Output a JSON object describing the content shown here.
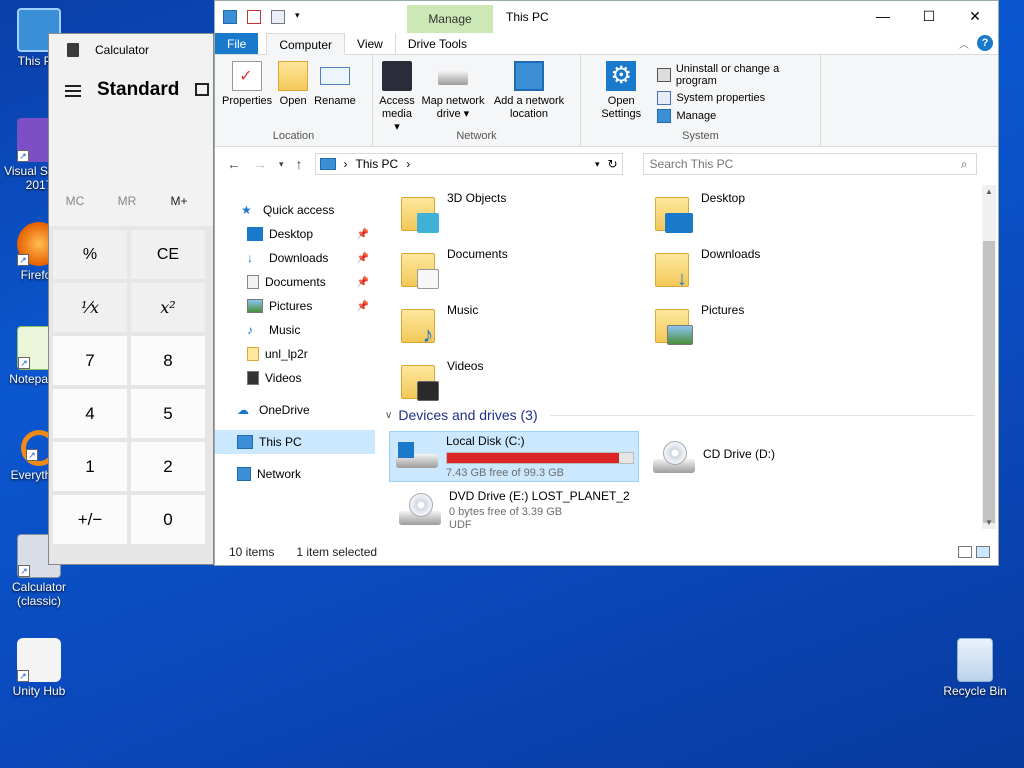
{
  "desktop": {
    "icons": [
      {
        "label": "This PC"
      },
      {
        "label": "Visual Studio 2017"
      },
      {
        "label": "Firefox"
      },
      {
        "label": "Notepad++"
      },
      {
        "label": "Everything"
      },
      {
        "label": "Calculator (classic)"
      },
      {
        "label": "Unity Hub"
      },
      {
        "label": "Recycle Bin"
      }
    ]
  },
  "calculator": {
    "title": "Calculator",
    "mode": "Standard",
    "memory": [
      "MC",
      "MR",
      "M+"
    ],
    "keys": [
      "%",
      "CE",
      "¹⁄x",
      "x²",
      "7",
      "8",
      "4",
      "5",
      "1",
      "2",
      "+/−",
      "0"
    ]
  },
  "explorer": {
    "title": "This PC",
    "manage_label": "Manage",
    "tabs": {
      "file": "File",
      "computer": "Computer",
      "view": "View",
      "drive_tools": "Drive Tools"
    },
    "ribbon": {
      "location": {
        "label": "Location",
        "properties": "Properties",
        "open": "Open",
        "rename": "Rename"
      },
      "network": {
        "label": "Network",
        "access_media": "Access media ▾",
        "map_network_drive": "Map network drive ▾",
        "add_network_location": "Add a network location"
      },
      "system": {
        "label": "System",
        "open_settings": "Open Settings",
        "uninstall": "Uninstall or change a program",
        "system_properties": "System properties",
        "manage": "Manage"
      }
    },
    "address": {
      "path": "This PC",
      "separator": "›",
      "search_placeholder": "Search This PC"
    },
    "nav": [
      {
        "label": "Quick access"
      },
      {
        "label": "Desktop"
      },
      {
        "label": "Downloads"
      },
      {
        "label": "Documents"
      },
      {
        "label": "Pictures"
      },
      {
        "label": "Music"
      },
      {
        "label": "unl_lp2r"
      },
      {
        "label": "Videos"
      },
      {
        "label": "OneDrive"
      },
      {
        "label": "This PC"
      },
      {
        "label": "Network"
      }
    ],
    "folders": [
      "3D Objects",
      "Desktop",
      "Documents",
      "Downloads",
      "Music",
      "Pictures",
      "Videos"
    ],
    "devices_header": "Devices and drives (3)",
    "drives": [
      {
        "name": "Local Disk (C:)",
        "free": "7.43 GB free of 99.3 GB",
        "used_fraction": 0.925
      },
      {
        "name": "CD Drive (D:)"
      },
      {
        "name": "DVD Drive (E:) LOST_PLANET_2",
        "free": "0 bytes free of 3.39 GB",
        "fs": "UDF"
      }
    ],
    "status": {
      "items": "10 items",
      "selected": "1 item selected"
    }
  }
}
